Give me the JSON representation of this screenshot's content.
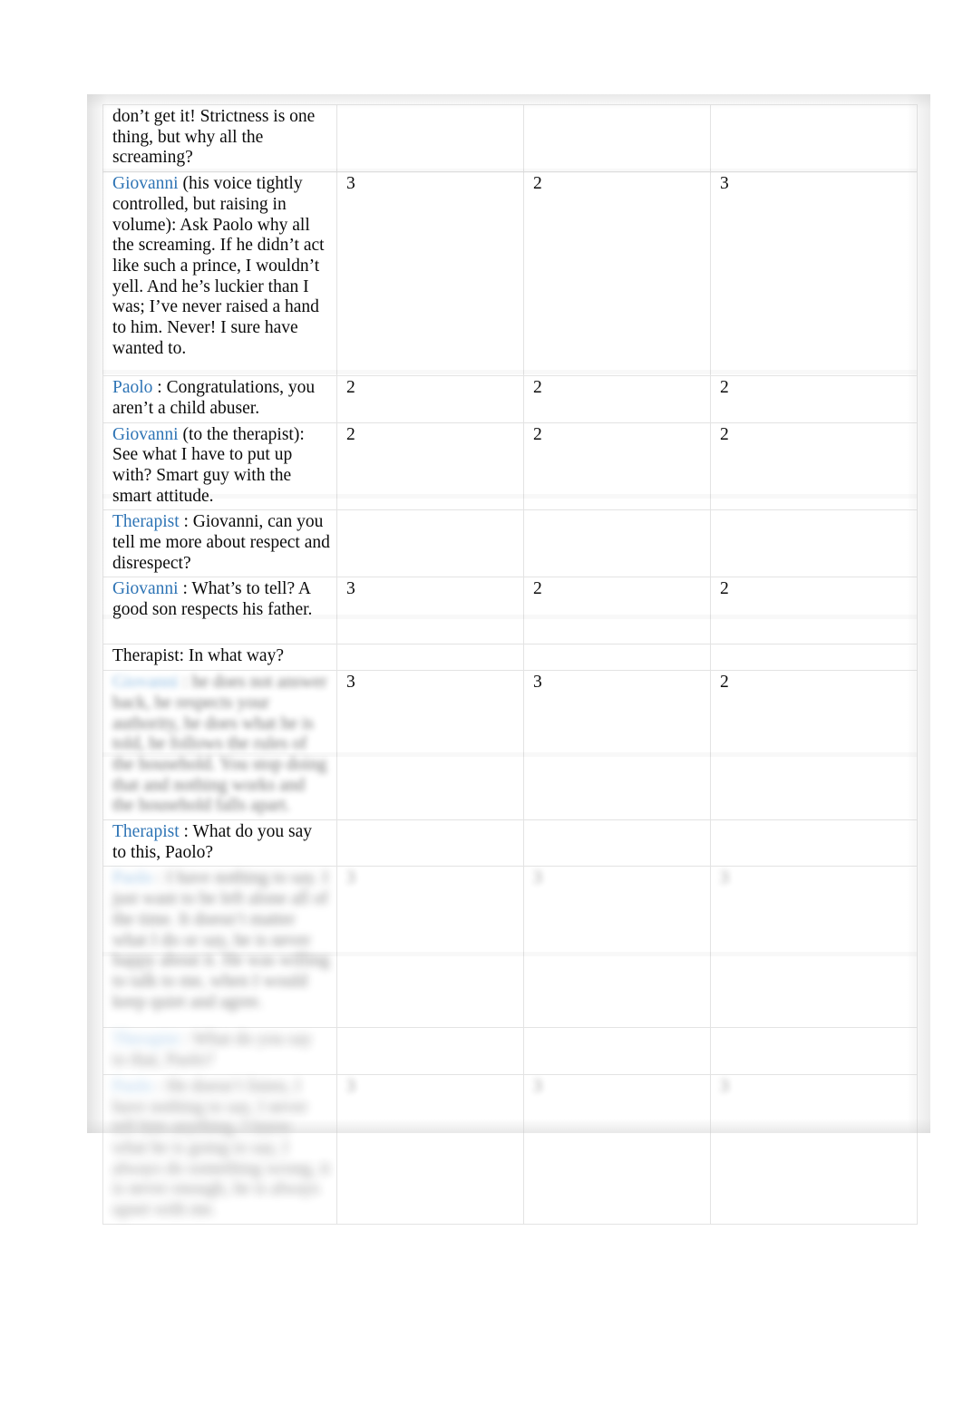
{
  "document": {
    "type": "transcript-coding-table",
    "page_background": "#ffffff",
    "speaker_color": "#2e74b5",
    "border_color": "#e3e3e3",
    "columns": 4
  },
  "rows": [
    {
      "id": "row-1",
      "speaker": "",
      "text": "don’t get it! Strictness is one thing, but why all the screaming?",
      "blurred": false,
      "scores": [
        "",
        "",
        ""
      ],
      "scores_blurred": false
    },
    {
      "id": "row-2",
      "speaker": "Giovanni",
      "text": " (his voice tightly controlled, but raising in volume): Ask Paolo why all the screaming. If he didn’t act like such a prince, I wouldn’t yell. And he’s luckier than I was; I’ve never raised a hand to him. Never! I sure have wanted to.",
      "blurred": false,
      "scores": [
        "3",
        "2",
        "3"
      ],
      "scores_blurred": false
    },
    {
      "id": "row-3",
      "speaker": "Paolo",
      "text": " : Congratulations, you aren’t a child abuser.",
      "blurred": false,
      "scores": [
        "2",
        "2",
        "2"
      ],
      "scores_blurred": false
    },
    {
      "id": "row-4",
      "speaker": "Giovanni",
      "text": " (to the therapist): See what I have to put up with? Smart guy with the smart attitude.",
      "blurred": false,
      "scores": [
        "2",
        "2",
        "2"
      ],
      "scores_blurred": false
    },
    {
      "id": "row-5",
      "speaker": "Therapist",
      "text": " : Giovanni, can you tell me more about respect and disrespect?",
      "blurred": false,
      "scores": [
        "",
        "",
        ""
      ],
      "scores_blurred": false
    },
    {
      "id": "row-6",
      "speaker": "Giovanni",
      "text": " : What’s to tell? A good son respects his father.",
      "blurred": false,
      "scores": [
        "3",
        "2",
        "2"
      ],
      "scores_blurred": false
    },
    {
      "id": "row-7",
      "speaker": "",
      "text": "Therapist: In what way?",
      "blurred": false,
      "scores": [
        "",
        "",
        ""
      ],
      "scores_blurred": false
    },
    {
      "id": "row-8",
      "speaker": "Giovanni",
      "text": " : he does not answer back, he respects your authority, he does what he is told, he follows the rules of the household. You stop doing that and nothing works and the household falls apart.",
      "blurred": true,
      "scores": [
        "3",
        "3",
        "2"
      ],
      "scores_blurred": false
    },
    {
      "id": "row-9",
      "speaker": "Therapist",
      "text": " : What do you say to this, Paolo?",
      "blurred": false,
      "scores": [
        "",
        "",
        ""
      ],
      "scores_blurred": false
    },
    {
      "id": "row-10",
      "speaker": "Paolo",
      "text": " : I have nothing to say. I just want to be left alone all of the time. It doesn’t matter what I do or say, he is never happy about it. He was willing to talk to me, when I would keep quiet and agree.",
      "blurred": true,
      "scores": [
        "3",
        "3",
        "3"
      ],
      "scores_blurred": true
    },
    {
      "id": "row-11",
      "speaker": "Therapist",
      "text": " : What do you say to that, Paolo?",
      "blurred": true,
      "scores": [
        "",
        "",
        ""
      ],
      "scores_blurred": false
    },
    {
      "id": "row-12",
      "speaker": "Paolo",
      "text": " : He doesn’t listen, I have nothing to say, I never tell him anything, I know what he is going to say, I always do something wrong, it is never enough, he is always upset with me.",
      "blurred": true,
      "scores": [
        "3",
        "3",
        "3"
      ],
      "scores_blurred": true
    }
  ]
}
